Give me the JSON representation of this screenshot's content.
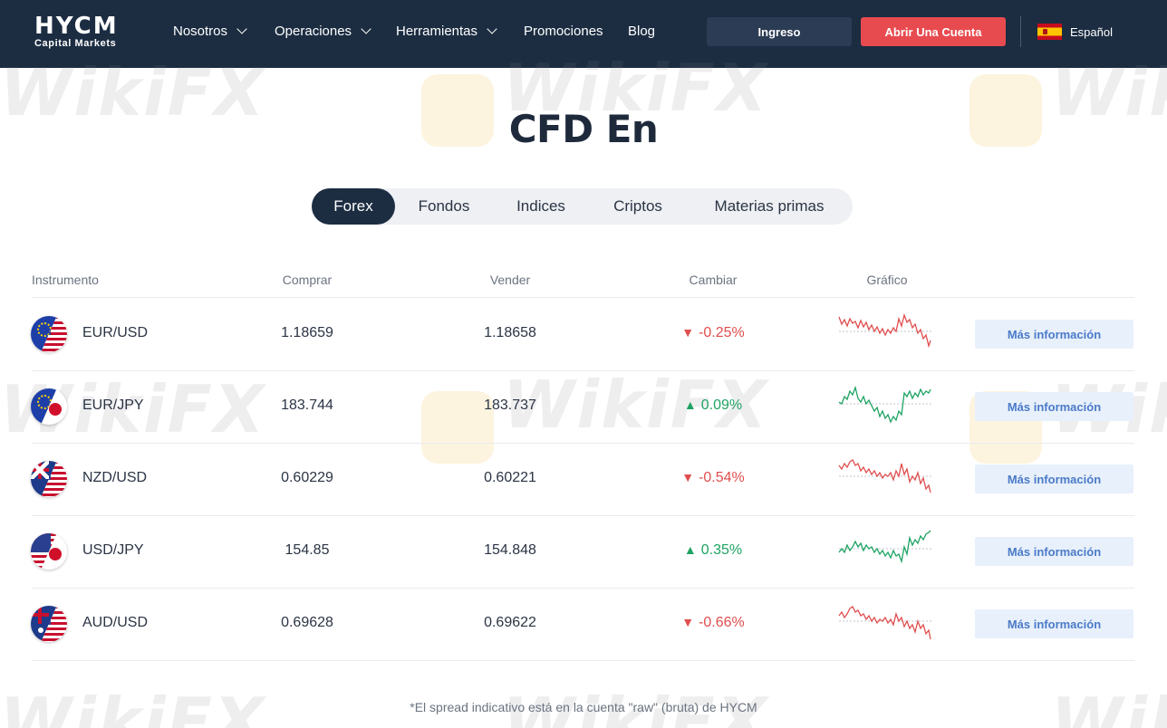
{
  "header": {
    "logo_main": "HYCM",
    "logo_sub": "Capital Markets",
    "nav": [
      {
        "label": "Nosotros",
        "dropdown": true
      },
      {
        "label": "Operaciones",
        "dropdown": true
      },
      {
        "label": "Herramientas",
        "dropdown": true
      },
      {
        "label": "Promociones",
        "dropdown": false
      },
      {
        "label": "Blog",
        "dropdown": false
      }
    ],
    "login_label": "Ingreso",
    "open_account_label": "Abrir Una Cuenta",
    "language": "Español"
  },
  "watermark_text": "WikiFX",
  "page_title": "CFD En",
  "tabs": [
    {
      "label": "Forex",
      "active": true
    },
    {
      "label": "Fondos",
      "active": false
    },
    {
      "label": "Indices",
      "active": false
    },
    {
      "label": "Criptos",
      "active": false
    },
    {
      "label": "Materias primas",
      "active": false
    }
  ],
  "table": {
    "headers": {
      "instrument": "Instrumento",
      "buy": "Comprar",
      "sell": "Vender",
      "change": "Cambiar",
      "chart": "Gráfico"
    },
    "more_label": "Más información",
    "rows": [
      {
        "instrument": "EUR/USD",
        "buy": "1.18659",
        "sell": "1.18658",
        "change": "-0.25%",
        "direction": "down",
        "flags": [
          "eu",
          "us"
        ]
      },
      {
        "instrument": "EUR/JPY",
        "buy": "183.744",
        "sell": "183.737",
        "change": "0.09%",
        "direction": "up",
        "flags": [
          "eu",
          "jp"
        ]
      },
      {
        "instrument": "NZD/USD",
        "buy": "0.60229",
        "sell": "0.60221",
        "change": "-0.54%",
        "direction": "down",
        "flags": [
          "nz",
          "us"
        ]
      },
      {
        "instrument": "USD/JPY",
        "buy": "154.85",
        "sell": "154.848",
        "change": "0.35%",
        "direction": "up",
        "flags": [
          "us",
          "jp"
        ]
      },
      {
        "instrument": "AUD/USD",
        "buy": "0.69628",
        "sell": "0.69622",
        "change": "-0.66%",
        "direction": "down",
        "flags": [
          "au",
          "us"
        ]
      }
    ]
  },
  "footnote": "*El spread indicativo está en la cuenta \"raw\" (bruta) de HYCM",
  "colors": {
    "header_bg": "#1c2d42",
    "accent_red": "#e84b4f",
    "down": "#e04e4e",
    "up": "#1ea362",
    "more_bg": "#e8f0fb",
    "more_text": "#4a7ac8"
  },
  "icons": {
    "down_arrow": "▼",
    "up_arrow": "▲"
  }
}
